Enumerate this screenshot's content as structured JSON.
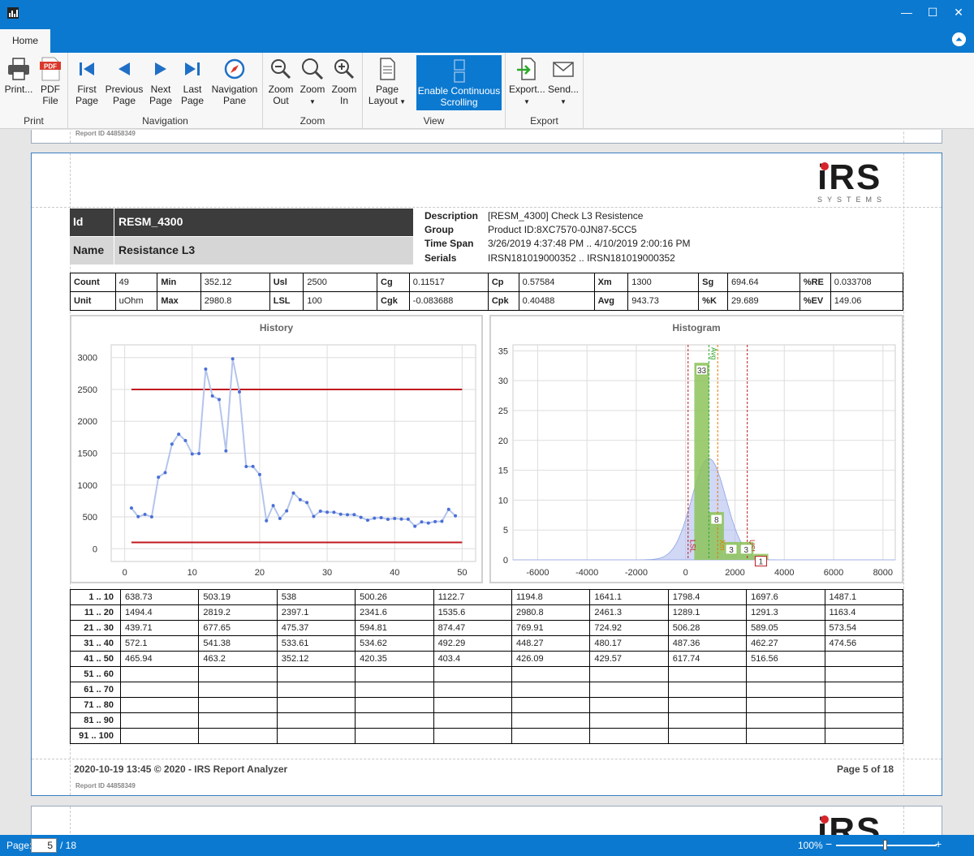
{
  "ribbon": {
    "tab_home": "Home",
    "groups": {
      "print": "Print",
      "navigation": "Navigation",
      "zoom": "Zoom",
      "view": "View",
      "export": "Export"
    },
    "buttons": {
      "print": "Print...",
      "pdf_file": [
        "PDF",
        "File"
      ],
      "first_page": [
        "First",
        "Page"
      ],
      "previous_page": [
        "Previous",
        "Page"
      ],
      "next_page": [
        "Next",
        "Page"
      ],
      "last_page": [
        "Last",
        "Page"
      ],
      "navigation_pane": [
        "Navigation",
        "Pane"
      ],
      "zoom_out": [
        "Zoom",
        "Out"
      ],
      "zoom": "Zoom",
      "zoom_in": [
        "Zoom",
        "In"
      ],
      "page_layout": [
        "Page",
        "Layout"
      ],
      "continuous_scrolling": [
        "Enable Continuous",
        "Scrolling"
      ],
      "export": "Export...",
      "send": "Send..."
    },
    "pdf_badge": "PDF"
  },
  "report": {
    "report_id_text": "Report ID  44858349",
    "logo_main": "iRS",
    "logo_sub": "SYSTEMS",
    "id_label": "Id",
    "id_value": "RESM_4300",
    "name_label": "Name",
    "name_value": "Resistance L3",
    "details": [
      {
        "k": "Description",
        "v": "[RESM_4300] Check L3 Resistence"
      },
      {
        "k": "Group",
        "v": "Product ID:8XC7570-0JN87-5CC5"
      },
      {
        "k": "Time Span",
        "v": "3/26/2019 4:37:48 PM .. 4/10/2019 2:00:16 PM"
      },
      {
        "k": "Serials",
        "v": "IRSN181019000352 .. IRSN181019000352"
      }
    ],
    "stats": [
      [
        [
          "Count",
          "49"
        ],
        [
          "Min",
          "352.12"
        ],
        [
          "Usl",
          "2500"
        ],
        [
          "Cg",
          "0.11517"
        ],
        [
          "Cp",
          "0.57584"
        ],
        [
          "Xm",
          "1300"
        ],
        [
          "Sg",
          "694.64"
        ],
        [
          "%RE",
          "0.033708"
        ]
      ],
      [
        [
          "Unit",
          "uOhm"
        ],
        [
          "Max",
          "2980.8"
        ],
        [
          "LSL",
          "100"
        ],
        [
          "Cgk",
          "-0.083688"
        ],
        [
          "Cpk",
          "0.40488"
        ],
        [
          "Avg",
          "943.73"
        ],
        [
          "%K",
          "29.689"
        ],
        [
          "%EV",
          "149.06"
        ]
      ]
    ],
    "value_rows": [
      {
        "label": "1 .. 10",
        "values": [
          "638.73",
          "503.19",
          "538",
          "500.26",
          "1122.7",
          "1194.8",
          "1641.1",
          "1798.4",
          "1697.6",
          "1487.1"
        ]
      },
      {
        "label": "11 .. 20",
        "values": [
          "1494.4",
          "2819.2",
          "2397.1",
          "2341.6",
          "1535.6",
          "2980.8",
          "2461.3",
          "1289.1",
          "1291.3",
          "1163.4"
        ]
      },
      {
        "label": "21 .. 30",
        "values": [
          "439.71",
          "677.65",
          "475.37",
          "594.81",
          "874.47",
          "769.91",
          "724.92",
          "506.28",
          "589.05",
          "573.54"
        ]
      },
      {
        "label": "31 .. 40",
        "values": [
          "572.1",
          "541.38",
          "533.61",
          "534.62",
          "492.29",
          "448.27",
          "480.17",
          "487.36",
          "462.27",
          "474.56"
        ]
      },
      {
        "label": "41 .. 50",
        "values": [
          "465.94",
          "463.2",
          "352.12",
          "420.35",
          "403.4",
          "426.09",
          "429.57",
          "617.74",
          "516.56",
          ""
        ]
      },
      {
        "label": "51 .. 60",
        "values": [
          "",
          "",
          "",
          "",
          "",
          "",
          "",
          "",
          "",
          ""
        ]
      },
      {
        "label": "61 .. 70",
        "values": [
          "",
          "",
          "",
          "",
          "",
          "",
          "",
          "",
          "",
          ""
        ]
      },
      {
        "label": "71 .. 80",
        "values": [
          "",
          "",
          "",
          "",
          "",
          "",
          "",
          "",
          "",
          ""
        ]
      },
      {
        "label": "81 .. 90",
        "values": [
          "",
          "",
          "",
          "",
          "",
          "",
          "",
          "",
          "",
          ""
        ]
      },
      {
        "label": "91 .. 100",
        "values": [
          "",
          "",
          "",
          "",
          "",
          "",
          "",
          "",
          "",
          ""
        ]
      }
    ],
    "footer_left": "2020-10-19 13:45 © 2020 - IRS Report Analyzer",
    "footer_right": "Page 5 of 18"
  },
  "chart_data": [
    {
      "type": "line",
      "title": "History",
      "x": [
        1,
        2,
        3,
        4,
        5,
        6,
        7,
        8,
        9,
        10,
        11,
        12,
        13,
        14,
        15,
        16,
        17,
        18,
        19,
        20,
        21,
        22,
        23,
        24,
        25,
        26,
        27,
        28,
        29,
        30,
        31,
        32,
        33,
        34,
        35,
        36,
        37,
        38,
        39,
        40,
        41,
        42,
        43,
        44,
        45,
        46,
        47,
        48,
        49
      ],
      "y": [
        638.73,
        503.19,
        538,
        500.26,
        1122.7,
        1194.8,
        1641.1,
        1798.4,
        1697.6,
        1487.1,
        1494.4,
        2819.2,
        2397.1,
        2341.6,
        1535.6,
        2980.8,
        2461.3,
        1289.1,
        1291.3,
        1163.4,
        439.71,
        677.65,
        475.37,
        594.81,
        874.47,
        769.91,
        724.92,
        506.28,
        589.05,
        573.54,
        572.1,
        541.38,
        533.61,
        534.62,
        492.29,
        448.27,
        480.17,
        487.36,
        462.27,
        474.56,
        465.94,
        463.2,
        352.12,
        420.35,
        403.4,
        426.09,
        429.57,
        617.74,
        516.56
      ],
      "limits": {
        "usl": 2500,
        "lsl": 100
      },
      "xlim": [
        -2,
        52
      ],
      "ylim": [
        -200,
        3200
      ],
      "xticks": [
        0,
        10,
        20,
        30,
        40,
        50
      ],
      "yticks": [
        0,
        500,
        1000,
        1500,
        2000,
        2500,
        3000
      ],
      "grid": true,
      "colors": {
        "line": "#b4c5ec",
        "points": "#4a6fd6",
        "limits": "#c0191e"
      }
    },
    {
      "type": "bar",
      "title": "Histogram",
      "bins": [
        {
          "start": 352,
          "end": 952,
          "count": 33
        },
        {
          "start": 952,
          "end": 1552,
          "count": 8
        },
        {
          "start": 1552,
          "end": 2152,
          "count": 3
        },
        {
          "start": 2152,
          "end": 2752,
          "count": 3
        },
        {
          "start": 2752,
          "end": 3352,
          "count": 1
        }
      ],
      "bin_labels": [
        "33",
        "8",
        "3",
        "3",
        "1"
      ],
      "reference_lines": {
        "lsl": 100,
        "avg": 943.73,
        "xm": 1300,
        "usl": 2500
      },
      "reference_labels": {
        "lsl": "LSL",
        "avg": "Avg",
        "xm": "Xm",
        "usl": "USL"
      },
      "distribution": {
        "mean": 943.73,
        "sd": 694.64,
        "peak": 17
      },
      "xlim": [
        -7000,
        8500
      ],
      "ylim": [
        0,
        36
      ],
      "xticks": [
        -6000,
        -4000,
        -2000,
        0,
        2000,
        4000,
        6000,
        8000
      ],
      "yticks": [
        0,
        5,
        10,
        15,
        20,
        25,
        30,
        35
      ],
      "grid": true,
      "colors": {
        "bars": "#8dc35a",
        "distribution": "#a9b8ee",
        "lsl": "#c0191e",
        "avg": "#2da82a",
        "xm": "#e07a00",
        "usl": "#c0191e"
      }
    }
  ],
  "statusbar": {
    "page_label": "Page:",
    "page_value": "5",
    "page_total": "/ 18",
    "zoom": "100%",
    "minus": "−",
    "plus": "+"
  },
  "window": {
    "min": "—",
    "max": "☐",
    "close": "✕"
  }
}
